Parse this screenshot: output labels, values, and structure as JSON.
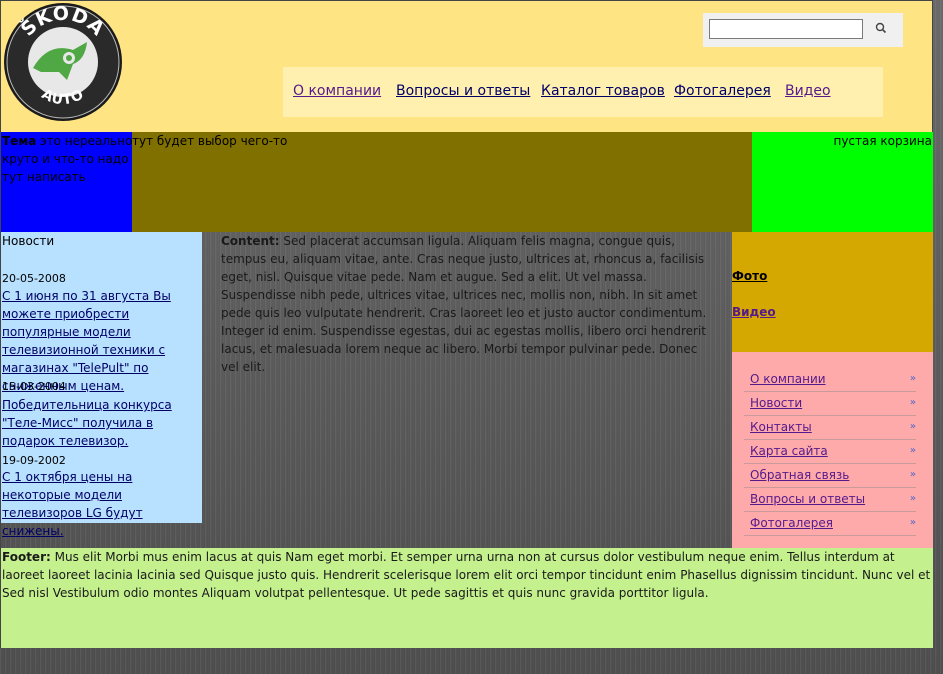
{
  "header": {
    "logo_text": "ŠKODA AUTO",
    "search": {
      "value": "",
      "placeholder": ""
    },
    "search_icon": "search-icon",
    "nav": [
      {
        "label": "О компании"
      },
      {
        "label": "Вопросы и ответы"
      },
      {
        "label": "Каталог товаров"
      },
      {
        "label": "Фотогалерея"
      },
      {
        "label": "Видео"
      }
    ]
  },
  "topic": {
    "label": "Тема",
    "text": "это нереально круто и что-то надо тут написать"
  },
  "select_area": {
    "text": "тут будет выбор чего-то"
  },
  "cart": {
    "text": "пустая корзина"
  },
  "news": {
    "title": "Новости",
    "items": [
      {
        "date": "20-05-2008",
        "text": "С 1 июня по 31 августа Вы можете приобрести популярные модели телевизионной техники с магазинах \"TelePult\" по сниженным ценам."
      },
      {
        "date": "15-03-2004",
        "text": "Победительница конкурса \"Теле-Мисс\" получила в подарок телевизор."
      },
      {
        "date": "19-09-2002",
        "text": "С 1 октября цены на некоторые модели телевизоров LG будут снижены."
      }
    ]
  },
  "content": {
    "label": "Content:",
    "text": "Sed placerat accumsan ligula. Aliquam felis magna, congue quis, tempus eu, aliquam vitae, ante. Cras neque justo, ultrices at, rhoncus a, facilisis eget, nisl. Quisque vitae pede. Nam et augue. Sed a elit. Ut vel massa. Suspendisse nibh pede, ultrices vitae, ultrices nec, mollis non, nibh. In sit amet pede quis leo vulputate hendrerit. Cras laoreet leo et justo auctor condimentum. Integer id enim. Suspendisse egestas, dui ac egestas mollis, libero orci hendrerit lacus, et malesuada lorem neque ac libero. Morbi tempor pulvinar pede. Donec vel elit."
  },
  "media": {
    "photo": "Фото",
    "video": "Видео"
  },
  "side_menu": [
    {
      "label": "О компании"
    },
    {
      "label": "Новости"
    },
    {
      "label": "Контакты"
    },
    {
      "label": "Карта сайта"
    },
    {
      "label": "Обратная связь"
    },
    {
      "label": "Вопросы и ответы"
    },
    {
      "label": "Фотогалерея"
    }
  ],
  "side_menu_chevron": "»",
  "footer": {
    "label": "Footer:",
    "text": "Mus elit Morbi mus enim lacus at quis Nam eget morbi. Et semper urna urna non at cursus dolor vestibulum neque enim. Tellus interdum at laoreet laoreet lacinia lacinia sed Quisque justo quis. Hendrerit scelerisque lorem elit orci tempor tincidunt enim Phasellus dignissim tincidunt. Nunc vel et Sed nisl Vestibulum odio montes Aliquam volutpat pellentesque. Ut pede sagittis et quis nunc gravida porttitor ligula."
  },
  "colors": {
    "header_bg": "#ffe484",
    "topic_bg": "#0000ff",
    "select_bg": "#807000",
    "cart_bg": "#00ff00",
    "news_bg": "#b8e0ff",
    "media_bg": "#d4a800",
    "menu_bg": "#ffaaaa",
    "footer_bg": "#c4f08e",
    "logo_green": "#4fa843"
  }
}
